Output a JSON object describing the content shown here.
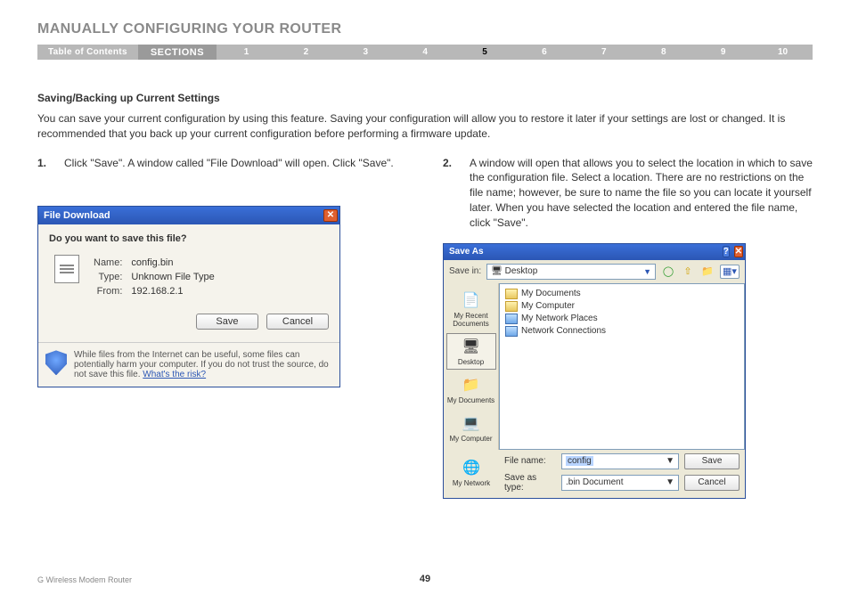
{
  "header": {
    "title": "MANUALLY CONFIGURING YOUR ROUTER",
    "toc_label": "Table of Contents",
    "sections_label": "SECTIONS",
    "tabs": [
      "1",
      "2",
      "3",
      "4",
      "5",
      "6",
      "7",
      "8",
      "9",
      "10"
    ],
    "active_tab": "5"
  },
  "body": {
    "subheading": "Saving/Backing up Current Settings",
    "intro": "You can save your current configuration by using this feature. Saving your configuration will allow you to restore it later if your settings are lost or changed. It is recommended that you back up your current configuration before performing a firmware update.",
    "step1_num": "1.",
    "step1_text": "Click \"Save\". A window called \"File Download\" will open. Click \"Save\".",
    "step2_num": "2.",
    "step2_text": "A window will open that allows you to select the location in which to save the configuration file. Select a location. There are no restrictions on the file name; however, be sure to name the file so you can locate it yourself later. When you have selected the location and entered the file name, click \"Save\"."
  },
  "file_download": {
    "title": "File Download",
    "question": "Do you want to save this file?",
    "name_label": "Name:",
    "name_value": "config.bin",
    "type_label": "Type:",
    "type_value": "Unknown File Type",
    "from_label": "From:",
    "from_value": "192.168.2.1",
    "save_btn": "Save",
    "cancel_btn": "Cancel",
    "warning_text": "While files from the Internet can be useful, some files can potentially harm your computer. If you do not trust the source, do not save this file. ",
    "warning_link": "What's the risk?"
  },
  "save_as": {
    "title": "Save As",
    "savein_label": "Save in:",
    "savein_value": "Desktop",
    "places": [
      {
        "label": "My Recent Documents",
        "icon": "📄"
      },
      {
        "label": "Desktop",
        "icon": "🖥"
      },
      {
        "label": "My Documents",
        "icon": "📁"
      },
      {
        "label": "My Computer",
        "icon": "💻"
      },
      {
        "label": "My Network",
        "icon": "🌐"
      }
    ],
    "items": [
      {
        "label": "My Documents",
        "type": "folder"
      },
      {
        "label": "My Computer",
        "type": "folder"
      },
      {
        "label": "My Network Places",
        "type": "netloc"
      },
      {
        "label": "Network Connections",
        "type": "netloc"
      }
    ],
    "filename_label": "File name:",
    "filename_value": "config",
    "savetype_label": "Save as type:",
    "savetype_value": ".bin Document",
    "save_btn": "Save",
    "cancel_btn": "Cancel"
  },
  "footer": {
    "product": "G Wireless Modem Router",
    "page": "49"
  }
}
